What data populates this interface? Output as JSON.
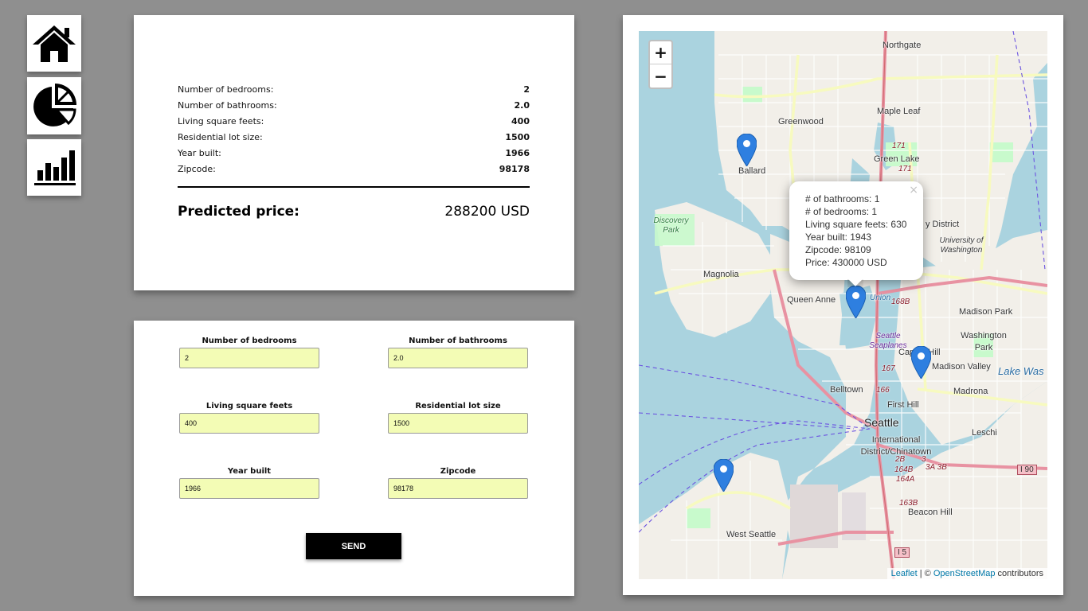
{
  "nav": {
    "items": [
      {
        "icon": "home-icon"
      },
      {
        "icon": "pie-chart-icon"
      },
      {
        "icon": "bar-chart-icon"
      }
    ]
  },
  "result": {
    "rows": [
      {
        "label": "Number of bedrooms:",
        "value": "2"
      },
      {
        "label": "Number of bathrooms:",
        "value": "2.0"
      },
      {
        "label": "Living square feets:",
        "value": "400"
      },
      {
        "label": "Residential lot size:",
        "value": "1500"
      },
      {
        "label": "Year built:",
        "value": "1966"
      },
      {
        "label": "Zipcode:",
        "value": "98178"
      }
    ],
    "predicted_label": "Predicted price:",
    "predicted_value": "288200 USD"
  },
  "form": {
    "fields": [
      {
        "label": "Number of bedrooms",
        "value": "2"
      },
      {
        "label": "Number of bathrooms",
        "value": "2.0"
      },
      {
        "label": "Living square feets",
        "value": "400"
      },
      {
        "label": "Residential lot size",
        "value": "1500"
      },
      {
        "label": "Year built",
        "value": "1966"
      },
      {
        "label": "Zipcode",
        "value": "98178"
      }
    ],
    "submit_label": "SEND"
  },
  "map": {
    "zoom_in": "+",
    "zoom_out": "−",
    "labels": {
      "northgate": "Northgate",
      "maple_leaf": "Maple Leaf",
      "greenwood": "Greenwood",
      "green_lake": "Green Lake",
      "ballard": "Ballard",
      "discovery_park": "Discovery Park",
      "magnolia": "Magnolia",
      "university_district": "y District",
      "university_of_washington": "University of Washington",
      "queen_anne": "Queen Anne",
      "union": "Union",
      "madison_park": "Madison Park",
      "washington_park": "Washington Park",
      "seattle_seaplanes": "Seattle Seaplanes",
      "capitol_hill": "Capitol Hill",
      "madison_valley": "Madison Valley",
      "lake_washington": "Lake Was",
      "belltown": "Belltown",
      "first_hill": "First Hill",
      "madrona": "Madrona",
      "seattle": "Seattle",
      "international_district": "International District/Chinatown",
      "leschi": "Leschi",
      "beacon_hill": "Beacon Hill",
      "west_seattle": "West Seattle",
      "route_171a": "171",
      "route_171b": "171",
      "route_168b": "168B",
      "route_167": "167",
      "route_166": "166",
      "route_164b": "164B",
      "route_164a": "164A",
      "route_163b": "163B",
      "route_2b": "2B",
      "route_3": "3",
      "route_3a3b": "3A 3B",
      "i90": "I 90",
      "i5": "I 5"
    },
    "popup": {
      "close": "×",
      "lines": [
        "# of bathrooms: 1",
        "# of bedrooms: 1",
        "Living square feets: 630",
        "Year built: 1943",
        "Zipcode: 98109",
        "Price: 430000 USD"
      ]
    },
    "attribution": {
      "leaflet": "Leaflet",
      "sep": " | © ",
      "osm": "OpenStreetMap",
      "suffix": " contributors"
    },
    "colors": {
      "water": "#aad3df",
      "land": "#f2efe9",
      "marker": "#2e7fe0",
      "motorway": "#e892a2",
      "primary": "#fcd6a4"
    }
  }
}
